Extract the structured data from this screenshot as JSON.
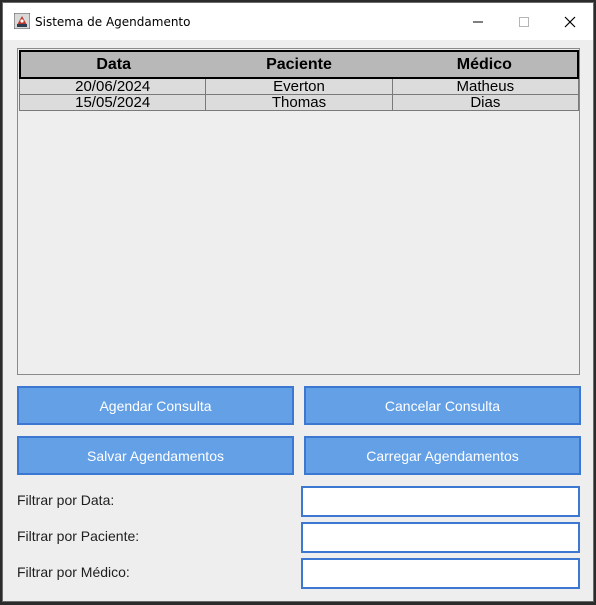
{
  "window": {
    "title": "Sistema de Agendamento"
  },
  "table": {
    "headers": [
      "Data",
      "Paciente",
      "Médico"
    ],
    "rows": [
      [
        "20/06/2024",
        "Everton",
        "Matheus"
      ],
      [
        "15/05/2024",
        "Thomas",
        "Dias"
      ]
    ]
  },
  "buttons": {
    "agendar": "Agendar Consulta",
    "cancelar": "Cancelar Consulta",
    "salvar": "Salvar Agendamentos",
    "carregar": "Carregar Agendamentos"
  },
  "filters": {
    "data_label": "Filtrar por Data:",
    "data_value": "",
    "paciente_label": "Filtrar por Paciente:",
    "paciente_value": "",
    "medico_label": "Filtrar por Médico:",
    "medico_value": ""
  },
  "colors": {
    "button_fill": "#64a0e6",
    "button_border": "#3c78d2",
    "header_fill": "#b8b8b8"
  },
  "icons": {
    "app": "java-app-icon",
    "minimize": "minimize-icon",
    "maximize": "maximize-icon",
    "close": "close-icon"
  }
}
